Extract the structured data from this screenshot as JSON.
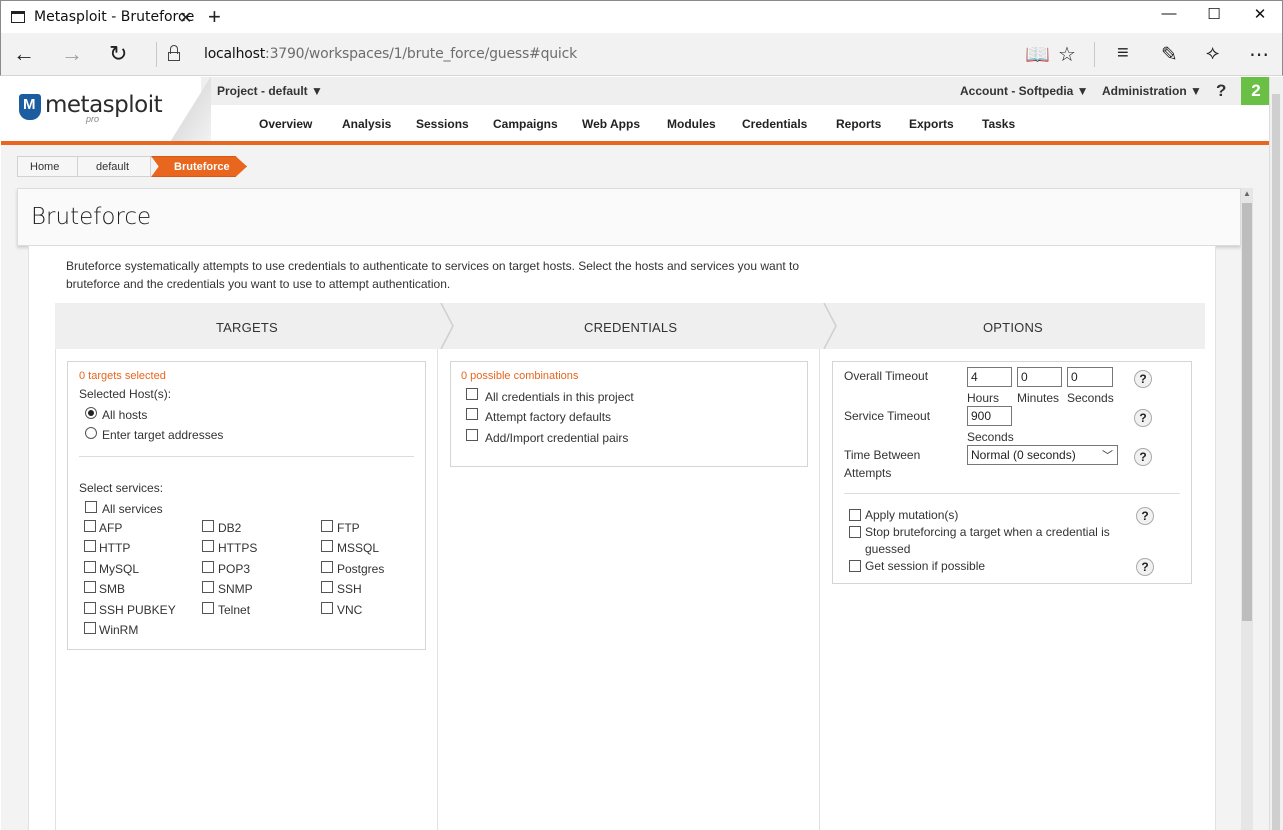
{
  "browser": {
    "tab_title": "Metasploit - Bruteforce",
    "tab_close": "✕",
    "new_tab": "+",
    "minimize": "—",
    "maximize": "☐",
    "close": "✕",
    "url_host": "localhost",
    "url_rest": ":3790/workspaces/1/brute_force/guess#quick"
  },
  "logo": {
    "text": "metasploit",
    "sub": "pro"
  },
  "header": {
    "project": "Project - default ▼",
    "account": "Account - Softpedia ▼",
    "administration": "Administration ▼",
    "help": "?",
    "notifications": "2"
  },
  "menu": [
    "Overview",
    "Analysis",
    "Sessions",
    "Campaigns",
    "Web Apps",
    "Modules",
    "Credentials",
    "Reports",
    "Exports",
    "Tasks"
  ],
  "breadcrumb": [
    "Home",
    "default",
    "Bruteforce"
  ],
  "page_title": "Bruteforce",
  "intro": "Bruteforce systematically attempts to use credentials to authenticate to services on target hosts. Select the hosts and services you want to bruteforce and the credentials you want to use to attempt authentication.",
  "steps": [
    "TARGETS",
    "CREDENTIALS",
    "OPTIONS"
  ],
  "targets": {
    "note": "0 targets selected",
    "hosts_label": "Selected Host(s):",
    "opt_all": "All hosts",
    "opt_enter": "Enter target addresses",
    "services_label": "Select services:",
    "all_services": "All services",
    "services": [
      "AFP",
      "DB2",
      "FTP",
      "HTTP",
      "HTTPS",
      "MSSQL",
      "MySQL",
      "POP3",
      "Postgres",
      "SMB",
      "SNMP",
      "SSH",
      "SSH PUBKEY",
      "Telnet",
      "VNC",
      "WinRM"
    ]
  },
  "credentials": {
    "note": "0 possible combinations",
    "items": [
      "All credentials in this project",
      "Attempt factory defaults",
      "Add/Import credential pairs"
    ]
  },
  "options": {
    "overall_timeout": "Overall Timeout",
    "hours_value": "4",
    "minutes_value": "0",
    "seconds_value": "0",
    "hours": "Hours",
    "minutes": "Minutes",
    "seconds": "Seconds",
    "service_timeout": "Service Timeout",
    "service_value": "900",
    "service_unit": "Seconds",
    "time_between_1": "Time Between",
    "time_between_2": "Attempts",
    "time_between_value": "Normal (0 seconds)",
    "apply_mutation": "Apply mutation(s)",
    "stop_1": "Stop bruteforcing a target when a credential is",
    "stop_2": "guessed",
    "get_session": "Get session if possible",
    "help": "?"
  },
  "colors": {
    "accent": "#e8661e",
    "notif": "#6abf45"
  }
}
